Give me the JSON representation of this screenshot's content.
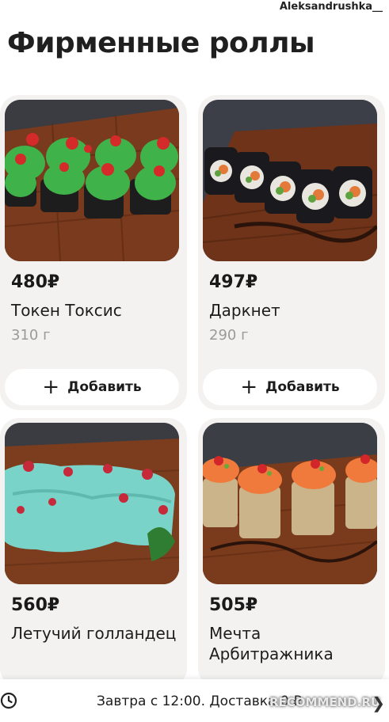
{
  "watermark_user": "Aleksandrushka__",
  "page_title": "Фирменные роллы",
  "products": [
    {
      "price": "480₽",
      "name": "Токен Токсис",
      "weight": "310 г",
      "add_label": "Добавить"
    },
    {
      "price": "497₽",
      "name": "Даркнет",
      "weight": "290 г",
      "add_label": "Добавить"
    },
    {
      "price": "560₽",
      "name": "Летучий голландец",
      "weight": "",
      "add_label": ""
    },
    {
      "price": "505₽",
      "name": "Мечта Арбитражника",
      "weight": "",
      "add_label": ""
    }
  ],
  "bottom_bar": {
    "delivery_text": "Завтра с 12:00. Доставка 0 ₽",
    "watermark": "RECOMMEND.RU"
  },
  "colors": {
    "card_bg": "#f3f2f0",
    "muted_text": "#9a9a9a",
    "wood": "#7a3a1e"
  },
  "icons": [
    "plus-icon",
    "clock-icon",
    "chevron-right-icon"
  ]
}
